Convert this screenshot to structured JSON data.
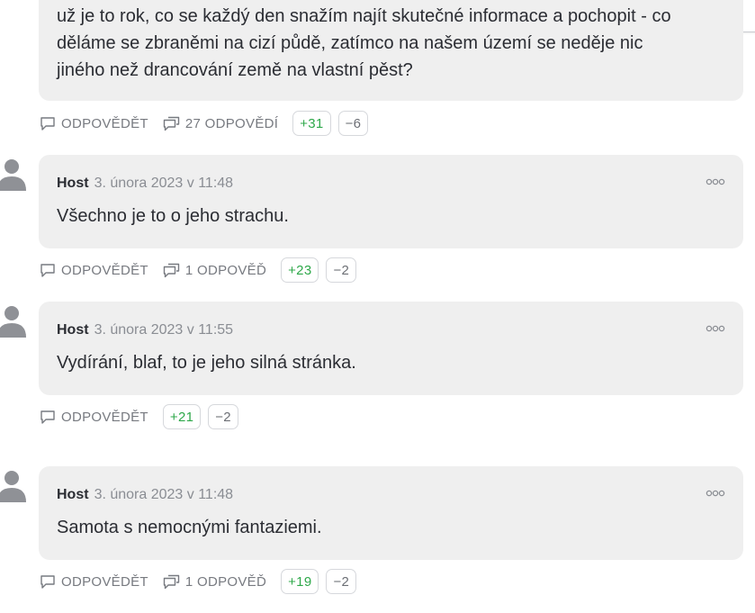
{
  "first_comment": {
    "lines": [
      "už je to rok, co se každý den snažím najít skutečné informace a pochopit - co",
      "děláme se zbraněmi na cizí půdě, zatímco na našem území se neděje nic",
      "jiného než drancování země na vlastní pěst?"
    ],
    "reply_label": "ODPOVĚDĚT",
    "replies_label": "27 ODPOVĚDÍ",
    "upvotes": "+31",
    "downvotes": "−6"
  },
  "comments": [
    {
      "author": "Host",
      "date": "3. února 2023 v 11:48",
      "text": "Všechno je to o jeho strachu.",
      "reply_label": "ODPOVĚDĚT",
      "replies_label": "1 ODPOVĚĎ",
      "upvotes": "+23",
      "downvotes": "−2"
    },
    {
      "author": "Host",
      "date": "3. února 2023 v 11:55",
      "text": "Vydírání, blaf, to je jeho silná stránka.",
      "reply_label": "ODPOVĚDĚT",
      "upvotes": "+21",
      "downvotes": "−2"
    },
    {
      "author": "Host",
      "date": "3. února 2023 v 11:48",
      "text": "Samota s nemocnými fantaziemi.",
      "reply_label": "ODPOVĚDĚT",
      "replies_label": "1 ODPOVĚĎ",
      "upvotes": "+19",
      "downvotes": "−2"
    }
  ],
  "icons": {
    "avatar": "user-avatar-icon",
    "reply": "speech-bubble-icon",
    "replies": "speech-bubbles-icon",
    "more": "more-dots-icon"
  },
  "colors": {
    "bubble": "#efefef",
    "upvote": "#2ea84a",
    "muted": "#777a80",
    "text": "#2b2d33"
  }
}
